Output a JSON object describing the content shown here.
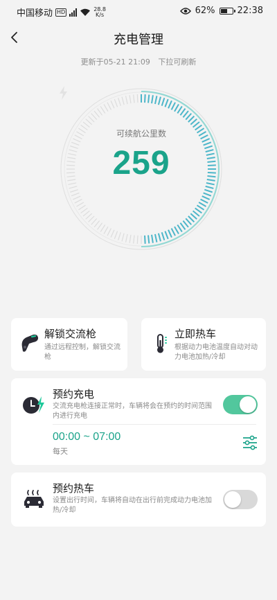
{
  "status_bar": {
    "carrier": "中国移动",
    "hd": "HD",
    "net_type": "4G",
    "speed_value": "28.8",
    "speed_unit": "K/s",
    "battery_percent": "62%",
    "battery_level": 0.62,
    "time": "22:38"
  },
  "header": {
    "title": "充电管理",
    "back_icon": "chevron-left-icon"
  },
  "update": {
    "time_text": "更新于05-21 21:09",
    "refresh_hint": "下拉可刷新"
  },
  "gauge": {
    "label": "可续航公里数",
    "value": "259",
    "fill_fraction": 0.5,
    "accent": "#1aa38a",
    "tick_active": "#4cb6c9"
  },
  "quick_cards": [
    {
      "title": "解锁交流枪",
      "desc": "通过远程控制，解锁交流枪",
      "icon": "charging-gun-icon"
    },
    {
      "title": "立即热车",
      "desc": "根据动力电池温度自动对动力电池加热/冷却",
      "icon": "thermometer-icon"
    }
  ],
  "scheduled_charge": {
    "title": "预约充电",
    "desc": "交流充电枪连接正常时，车辆将会在预约的时间范围内进行充电",
    "icon": "scheduled-charge-icon",
    "enabled": true,
    "time_range": "00:00 ~ 07:00",
    "repeat": "每天",
    "settings_icon": "sliders-icon"
  },
  "scheduled_heat": {
    "title": "预约热车",
    "desc": "设置出行时间，车辆将自动在出行前完成动力电池加热/冷却",
    "icon": "car-heating-icon",
    "enabled": false
  },
  "colors": {
    "accent": "#1aa38a",
    "toggle_on": "#52c79d",
    "toggle_off": "#d9d9d9",
    "background": "#f3f3f3"
  }
}
